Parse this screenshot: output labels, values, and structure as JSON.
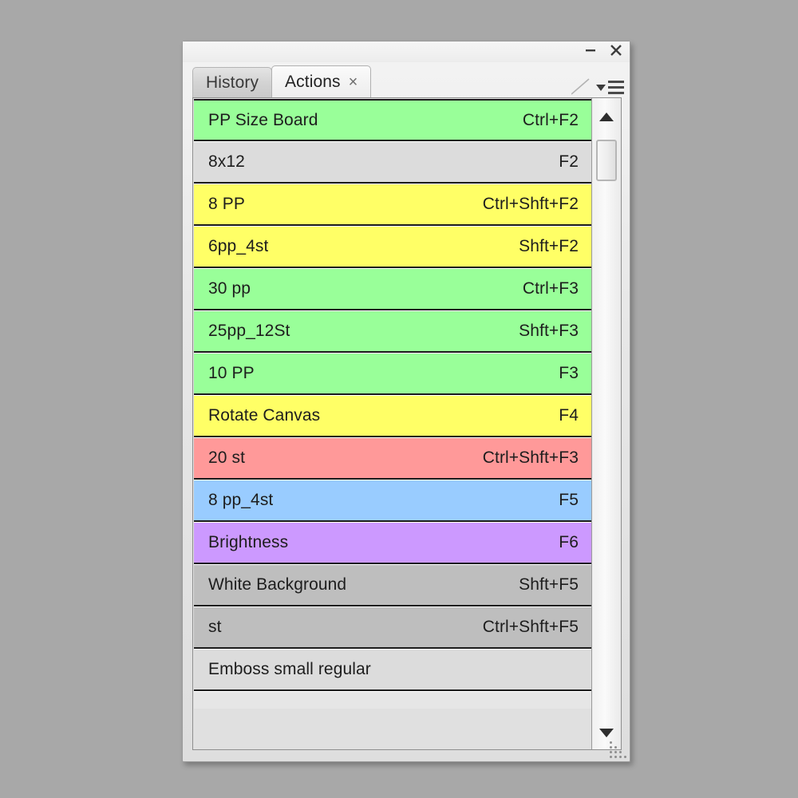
{
  "window": {
    "minimize_label": "minimize",
    "close_label": "close",
    "panel_menu_label": "panel-menu"
  },
  "tabs": [
    {
      "label": "History",
      "active": false,
      "closable": false
    },
    {
      "label": "Actions",
      "active": true,
      "closable": true,
      "close_glyph": "×"
    }
  ],
  "colors": {
    "green": "#99ff99",
    "yellow": "#ffff66",
    "salmon": "#ff9999",
    "blue": "#99ccff",
    "purple": "#cc99ff",
    "gray_light": "#dcdcdc",
    "gray_dark": "#bebebe",
    "panel_bg": "#e7e7e7",
    "desktop_bg": "#a8a8a8",
    "text": "#1d1d1d"
  },
  "actions": [
    {
      "name": "PP Size Board",
      "shortcut": "Ctrl+F2",
      "color": "#99ff99"
    },
    {
      "name": "8x12",
      "shortcut": "F2",
      "color": "#dcdcdc"
    },
    {
      "name": "8 PP",
      "shortcut": "Ctrl+Shft+F2",
      "color": "#ffff66"
    },
    {
      "name": "6pp_4st",
      "shortcut": "Shft+F2",
      "color": "#ffff66"
    },
    {
      "name": "30 pp",
      "shortcut": "Ctrl+F3",
      "color": "#99ff99"
    },
    {
      "name": "25pp_12St",
      "shortcut": "Shft+F3",
      "color": "#99ff99"
    },
    {
      "name": "10 PP",
      "shortcut": "F3",
      "color": "#99ff99"
    },
    {
      "name": "Rotate Canvas",
      "shortcut": "F4",
      "color": "#ffff66"
    },
    {
      "name": "20 st",
      "shortcut": "Ctrl+Shft+F3",
      "color": "#ff9999"
    },
    {
      "name": "8 pp_4st",
      "shortcut": "F5",
      "color": "#99ccff"
    },
    {
      "name": "Brightness",
      "shortcut": "F6",
      "color": "#cc99ff"
    },
    {
      "name": "White Background",
      "shortcut": "Shft+F5",
      "color": "#bebebe"
    },
    {
      "name": "st",
      "shortcut": "Ctrl+Shft+F5",
      "color": "#bebebe"
    },
    {
      "name": "Emboss small regular",
      "shortcut": "",
      "color": "#dcdcdc"
    }
  ],
  "scrollbar": {
    "up_arrow": "scroll-up",
    "down_arrow": "scroll-down",
    "thumb": "scroll-thumb"
  }
}
